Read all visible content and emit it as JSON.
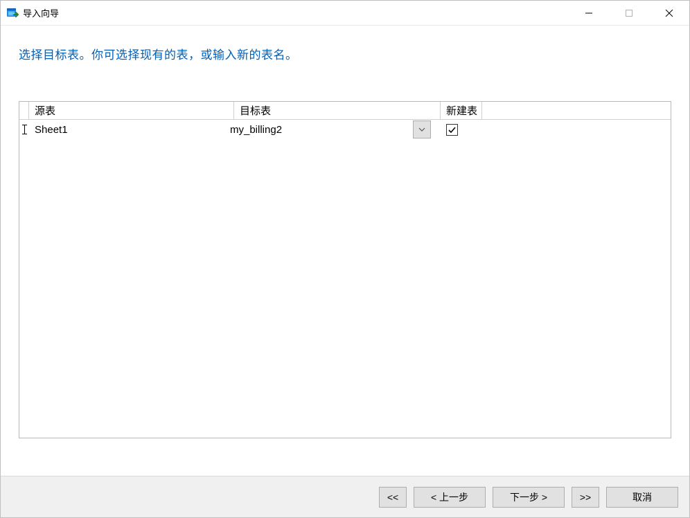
{
  "window": {
    "title": "导入向导"
  },
  "instruction": "选择目标表。你可选择现有的表，或输入新的表名。",
  "grid": {
    "headers": {
      "source": "源表",
      "target": "目标表",
      "newtable": "新建表"
    },
    "rows": [
      {
        "source": "Sheet1",
        "target": "my_billing2",
        "new_table_checked": true
      }
    ]
  },
  "buttons": {
    "first": "<<",
    "prev": "< 上一步",
    "next": "下一步 >",
    "last": ">>",
    "cancel": "取消"
  }
}
